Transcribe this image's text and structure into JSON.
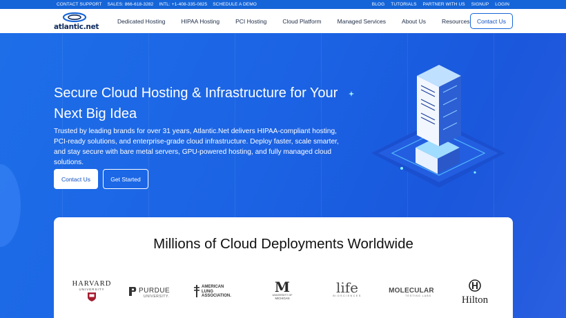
{
  "topbar": {
    "left": [
      "CONTACT SUPPORT",
      "SALES: 866-618-3282",
      "INTL: +1-408-335-0825",
      "SCHEDULE A DEMO"
    ],
    "right": [
      "BLOG",
      "TUTORIALS",
      "PARTNER WITH US",
      "SIGNUP",
      "LOGIN"
    ]
  },
  "logo": {
    "text": "atlantic.net"
  },
  "nav": {
    "items": [
      "Dedicated Hosting",
      "HIPAA Hosting",
      "PCI Hosting",
      "Cloud Platform",
      "Managed Services",
      "About Us",
      "Resources"
    ],
    "cta": "Contact Us"
  },
  "hero": {
    "title": "Secure Cloud Hosting & Infrastructure for Your Next Big Idea",
    "description": "Trusted by leading brands for over 31 years, Atlantic.Net delivers HIPAA-compliant hosting, PCI-ready solutions, and enterprise-grade cloud infrastructure. Deploy faster, scale smarter, and stay secure with bare metal servers, GPU-powered hosting, and fully managed cloud solutions.",
    "primary_button": "Contact Us",
    "secondary_button": "Get Started"
  },
  "deployments": {
    "title": "Millions of Cloud Deployments Worldwide",
    "logos": {
      "harvard": {
        "name": "HARVARD",
        "sub": "UNIVERSITY"
      },
      "purdue": {
        "name": "PURDUE",
        "sub": "UNIVERSITY."
      },
      "lung": {
        "l1": "AMERICAN",
        "l2": "LUNG",
        "l3": "ASSOCIATION."
      },
      "michigan": {
        "mark": "M",
        "sub1": "UNIVERSITY OF",
        "sub2": "MICHIGAN"
      },
      "life": {
        "name": "life",
        "sub": "BIOSCIENCES"
      },
      "molecular": {
        "name": "MOLECULAR",
        "sub": "TESTING LABS"
      },
      "hilton": {
        "mark": "H",
        "name": "Hilton"
      }
    }
  },
  "colors": {
    "brand_blue": "#1565d8",
    "hero_blue": "#1b63e4",
    "navy": "#0d2a5c"
  }
}
